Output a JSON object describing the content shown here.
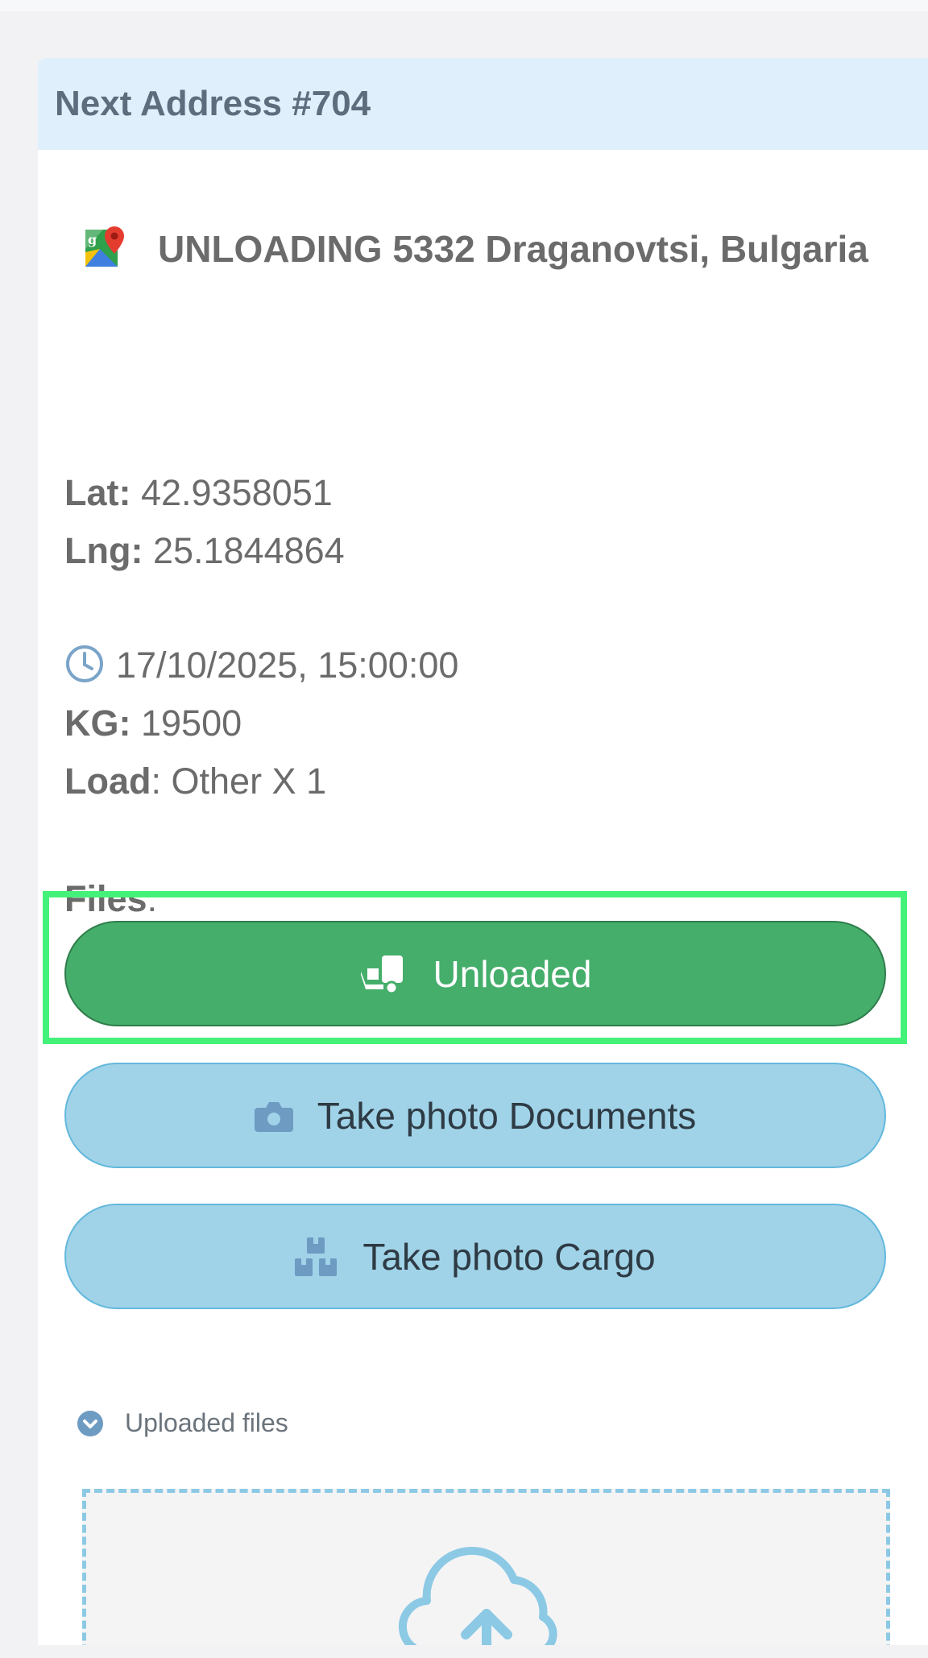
{
  "card": {
    "title": "Next Address #704"
  },
  "address": {
    "text": "UNLOADING 5332 Draganovtsi, Bulgaria",
    "icon": "google-maps-icon"
  },
  "coords": {
    "lat_label": "Lat:",
    "lat_value": " 42.9358051",
    "lng_label": "Lng:",
    "lng_value": " 25.1844864"
  },
  "details": {
    "datetime": "17/10/2025, 15:00:00",
    "kg_label": "KG:",
    "kg_value": " 19500",
    "load_label": "Load",
    "load_value": ": Other X 1",
    "files_label": "Files",
    "files_colon": ":"
  },
  "buttons": {
    "unloaded": "Unloaded",
    "take_photo_documents": "Take photo Documents",
    "take_photo_cargo": "Take photo Cargo"
  },
  "uploaded": {
    "label": "Uploaded files"
  },
  "colors": {
    "header_bg": "#dff0fc",
    "unloaded_green": "#45ae6b",
    "photo_blue": "#a0d3e8",
    "highlight": "#44f27a"
  }
}
